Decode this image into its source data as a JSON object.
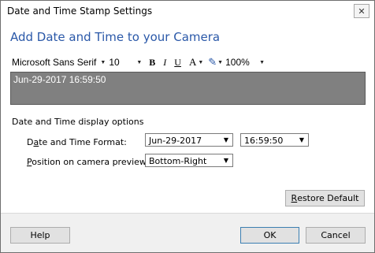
{
  "window": {
    "title": "Date and Time Stamp Settings"
  },
  "heading": "Add Date and Time to your Camera",
  "toolbar": {
    "font_name": "Microsoft Sans Serif",
    "font_size": "10",
    "bold": "B",
    "italic": "I",
    "underline": "U",
    "font_color": "A",
    "zoom": "100%"
  },
  "preview": {
    "text": "Jun-29-2017 16:59:50"
  },
  "options": {
    "section_label": "Date and Time display options",
    "format_label_pre": "D",
    "format_label_ul": "a",
    "format_label_post": "te and Time Format:",
    "date_format": "Jun-29-2017",
    "time_format": "16:59:50",
    "position_label_ul": "P",
    "position_label_post": "osition on camera preview:",
    "position": "Bottom-Right"
  },
  "buttons": {
    "restore_ul": "R",
    "restore_post": "estore Default",
    "help": "Help",
    "ok": "OK",
    "cancel": "Cancel"
  },
  "colors": {
    "heading": "#2a58a8",
    "preview_bg": "#808080"
  }
}
